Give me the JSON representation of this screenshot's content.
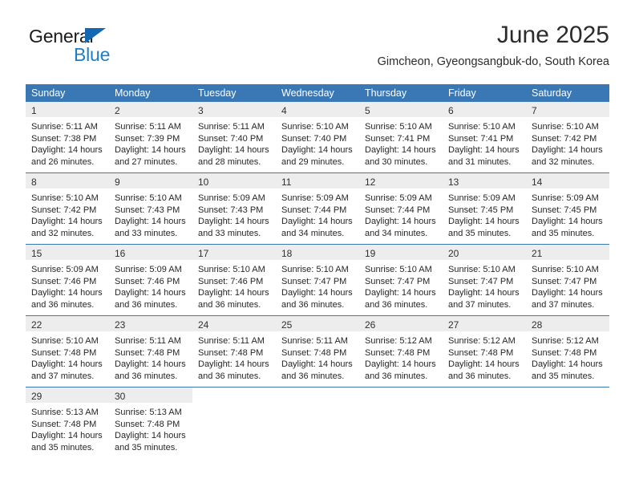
{
  "brand": {
    "name_top": "General",
    "name_bottom": "Blue",
    "accent_color": "#1268b3",
    "blue_text_color": "#1d7ec8"
  },
  "header": {
    "title": "June 2025",
    "subtitle": "Gimcheon, Gyeongsangbuk-do, South Korea"
  },
  "calendar": {
    "header_bg": "#3a77b5",
    "daynum_bg": "#ededed",
    "weekdays": [
      "Sunday",
      "Monday",
      "Tuesday",
      "Wednesday",
      "Thursday",
      "Friday",
      "Saturday"
    ],
    "weeks": [
      [
        {
          "day": "1",
          "sunrise": "Sunrise: 5:11 AM",
          "sunset": "Sunset: 7:38 PM",
          "daylight_line1": "Daylight: 14 hours",
          "daylight_line2": "and 26 minutes."
        },
        {
          "day": "2",
          "sunrise": "Sunrise: 5:11 AM",
          "sunset": "Sunset: 7:39 PM",
          "daylight_line1": "Daylight: 14 hours",
          "daylight_line2": "and 27 minutes."
        },
        {
          "day": "3",
          "sunrise": "Sunrise: 5:11 AM",
          "sunset": "Sunset: 7:40 PM",
          "daylight_line1": "Daylight: 14 hours",
          "daylight_line2": "and 28 minutes."
        },
        {
          "day": "4",
          "sunrise": "Sunrise: 5:10 AM",
          "sunset": "Sunset: 7:40 PM",
          "daylight_line1": "Daylight: 14 hours",
          "daylight_line2": "and 29 minutes."
        },
        {
          "day": "5",
          "sunrise": "Sunrise: 5:10 AM",
          "sunset": "Sunset: 7:41 PM",
          "daylight_line1": "Daylight: 14 hours",
          "daylight_line2": "and 30 minutes."
        },
        {
          "day": "6",
          "sunrise": "Sunrise: 5:10 AM",
          "sunset": "Sunset: 7:41 PM",
          "daylight_line1": "Daylight: 14 hours",
          "daylight_line2": "and 31 minutes."
        },
        {
          "day": "7",
          "sunrise": "Sunrise: 5:10 AM",
          "sunset": "Sunset: 7:42 PM",
          "daylight_line1": "Daylight: 14 hours",
          "daylight_line2": "and 32 minutes."
        }
      ],
      [
        {
          "day": "8",
          "sunrise": "Sunrise: 5:10 AM",
          "sunset": "Sunset: 7:42 PM",
          "daylight_line1": "Daylight: 14 hours",
          "daylight_line2": "and 32 minutes."
        },
        {
          "day": "9",
          "sunrise": "Sunrise: 5:10 AM",
          "sunset": "Sunset: 7:43 PM",
          "daylight_line1": "Daylight: 14 hours",
          "daylight_line2": "and 33 minutes."
        },
        {
          "day": "10",
          "sunrise": "Sunrise: 5:09 AM",
          "sunset": "Sunset: 7:43 PM",
          "daylight_line1": "Daylight: 14 hours",
          "daylight_line2": "and 33 minutes."
        },
        {
          "day": "11",
          "sunrise": "Sunrise: 5:09 AM",
          "sunset": "Sunset: 7:44 PM",
          "daylight_line1": "Daylight: 14 hours",
          "daylight_line2": "and 34 minutes."
        },
        {
          "day": "12",
          "sunrise": "Sunrise: 5:09 AM",
          "sunset": "Sunset: 7:44 PM",
          "daylight_line1": "Daylight: 14 hours",
          "daylight_line2": "and 34 minutes."
        },
        {
          "day": "13",
          "sunrise": "Sunrise: 5:09 AM",
          "sunset": "Sunset: 7:45 PM",
          "daylight_line1": "Daylight: 14 hours",
          "daylight_line2": "and 35 minutes."
        },
        {
          "day": "14",
          "sunrise": "Sunrise: 5:09 AM",
          "sunset": "Sunset: 7:45 PM",
          "daylight_line1": "Daylight: 14 hours",
          "daylight_line2": "and 35 minutes."
        }
      ],
      [
        {
          "day": "15",
          "sunrise": "Sunrise: 5:09 AM",
          "sunset": "Sunset: 7:46 PM",
          "daylight_line1": "Daylight: 14 hours",
          "daylight_line2": "and 36 minutes."
        },
        {
          "day": "16",
          "sunrise": "Sunrise: 5:09 AM",
          "sunset": "Sunset: 7:46 PM",
          "daylight_line1": "Daylight: 14 hours",
          "daylight_line2": "and 36 minutes."
        },
        {
          "day": "17",
          "sunrise": "Sunrise: 5:10 AM",
          "sunset": "Sunset: 7:46 PM",
          "daylight_line1": "Daylight: 14 hours",
          "daylight_line2": "and 36 minutes."
        },
        {
          "day": "18",
          "sunrise": "Sunrise: 5:10 AM",
          "sunset": "Sunset: 7:47 PM",
          "daylight_line1": "Daylight: 14 hours",
          "daylight_line2": "and 36 minutes."
        },
        {
          "day": "19",
          "sunrise": "Sunrise: 5:10 AM",
          "sunset": "Sunset: 7:47 PM",
          "daylight_line1": "Daylight: 14 hours",
          "daylight_line2": "and 36 minutes."
        },
        {
          "day": "20",
          "sunrise": "Sunrise: 5:10 AM",
          "sunset": "Sunset: 7:47 PM",
          "daylight_line1": "Daylight: 14 hours",
          "daylight_line2": "and 37 minutes."
        },
        {
          "day": "21",
          "sunrise": "Sunrise: 5:10 AM",
          "sunset": "Sunset: 7:47 PM",
          "daylight_line1": "Daylight: 14 hours",
          "daylight_line2": "and 37 minutes."
        }
      ],
      [
        {
          "day": "22",
          "sunrise": "Sunrise: 5:10 AM",
          "sunset": "Sunset: 7:48 PM",
          "daylight_line1": "Daylight: 14 hours",
          "daylight_line2": "and 37 minutes."
        },
        {
          "day": "23",
          "sunrise": "Sunrise: 5:11 AM",
          "sunset": "Sunset: 7:48 PM",
          "daylight_line1": "Daylight: 14 hours",
          "daylight_line2": "and 36 minutes."
        },
        {
          "day": "24",
          "sunrise": "Sunrise: 5:11 AM",
          "sunset": "Sunset: 7:48 PM",
          "daylight_line1": "Daylight: 14 hours",
          "daylight_line2": "and 36 minutes."
        },
        {
          "day": "25",
          "sunrise": "Sunrise: 5:11 AM",
          "sunset": "Sunset: 7:48 PM",
          "daylight_line1": "Daylight: 14 hours",
          "daylight_line2": "and 36 minutes."
        },
        {
          "day": "26",
          "sunrise": "Sunrise: 5:12 AM",
          "sunset": "Sunset: 7:48 PM",
          "daylight_line1": "Daylight: 14 hours",
          "daylight_line2": "and 36 minutes."
        },
        {
          "day": "27",
          "sunrise": "Sunrise: 5:12 AM",
          "sunset": "Sunset: 7:48 PM",
          "daylight_line1": "Daylight: 14 hours",
          "daylight_line2": "and 36 minutes."
        },
        {
          "day": "28",
          "sunrise": "Sunrise: 5:12 AM",
          "sunset": "Sunset: 7:48 PM",
          "daylight_line1": "Daylight: 14 hours",
          "daylight_line2": "and 35 minutes."
        }
      ],
      [
        {
          "day": "29",
          "sunrise": "Sunrise: 5:13 AM",
          "sunset": "Sunset: 7:48 PM",
          "daylight_line1": "Daylight: 14 hours",
          "daylight_line2": "and 35 minutes."
        },
        {
          "day": "30",
          "sunrise": "Sunrise: 5:13 AM",
          "sunset": "Sunset: 7:48 PM",
          "daylight_line1": "Daylight: 14 hours",
          "daylight_line2": "and 35 minutes."
        },
        {
          "day": "",
          "sunrise": "",
          "sunset": "",
          "daylight_line1": "",
          "daylight_line2": ""
        },
        {
          "day": "",
          "sunrise": "",
          "sunset": "",
          "daylight_line1": "",
          "daylight_line2": ""
        },
        {
          "day": "",
          "sunrise": "",
          "sunset": "",
          "daylight_line1": "",
          "daylight_line2": ""
        },
        {
          "day": "",
          "sunrise": "",
          "sunset": "",
          "daylight_line1": "",
          "daylight_line2": ""
        },
        {
          "day": "",
          "sunrise": "",
          "sunset": "",
          "daylight_line1": "",
          "daylight_line2": ""
        }
      ]
    ]
  }
}
